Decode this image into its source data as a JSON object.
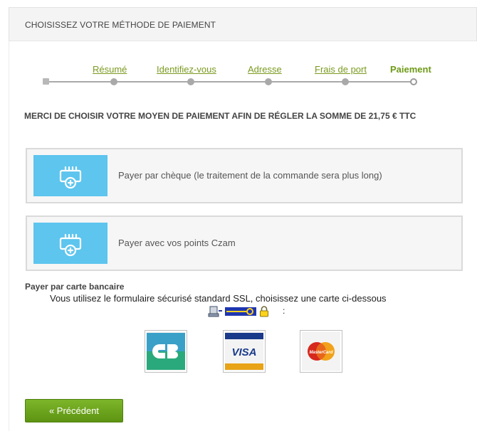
{
  "header": {
    "title": "CHOISISSEZ VOTRE MÉTHODE DE PAIEMENT"
  },
  "steps": [
    {
      "label": "Résumé",
      "state": "done"
    },
    {
      "label": "Identifiez-vous",
      "state": "done"
    },
    {
      "label": "Adresse",
      "state": "done"
    },
    {
      "label": "Frais de port",
      "state": "done"
    },
    {
      "label": "Paiement",
      "state": "current"
    }
  ],
  "amount_message": "MERCI DE CHOISIR VOTRE MOYEN DE PAIEMENT AFIN DE RÉGLER LA SOMME DE 21,75 € TTC",
  "payment_options": [
    {
      "label": "Payer par chèque (le traitement de la commande sera plus long)",
      "icon": "cheque-icon"
    },
    {
      "label": "Payer avec vos points Czam",
      "icon": "points-icon"
    }
  ],
  "card_section": {
    "title": "Payer par carte bancaire",
    "subtitle": "Vous utilisez le formulaire sécurisé standard SSL, choisissez une carte ci-dessous",
    "colon": ":",
    "cards": [
      {
        "name": "CB",
        "icon": "cb-card-icon"
      },
      {
        "name": "VISA",
        "icon": "visa-card-icon"
      },
      {
        "name": "MasterCard",
        "icon": "mastercard-icon"
      }
    ]
  },
  "buttons": {
    "previous": "« Précédent"
  },
  "colors": {
    "accent_green": "#6e9a17",
    "icon_blue": "#5dc5ee",
    "button_green": "#6aa51c"
  }
}
